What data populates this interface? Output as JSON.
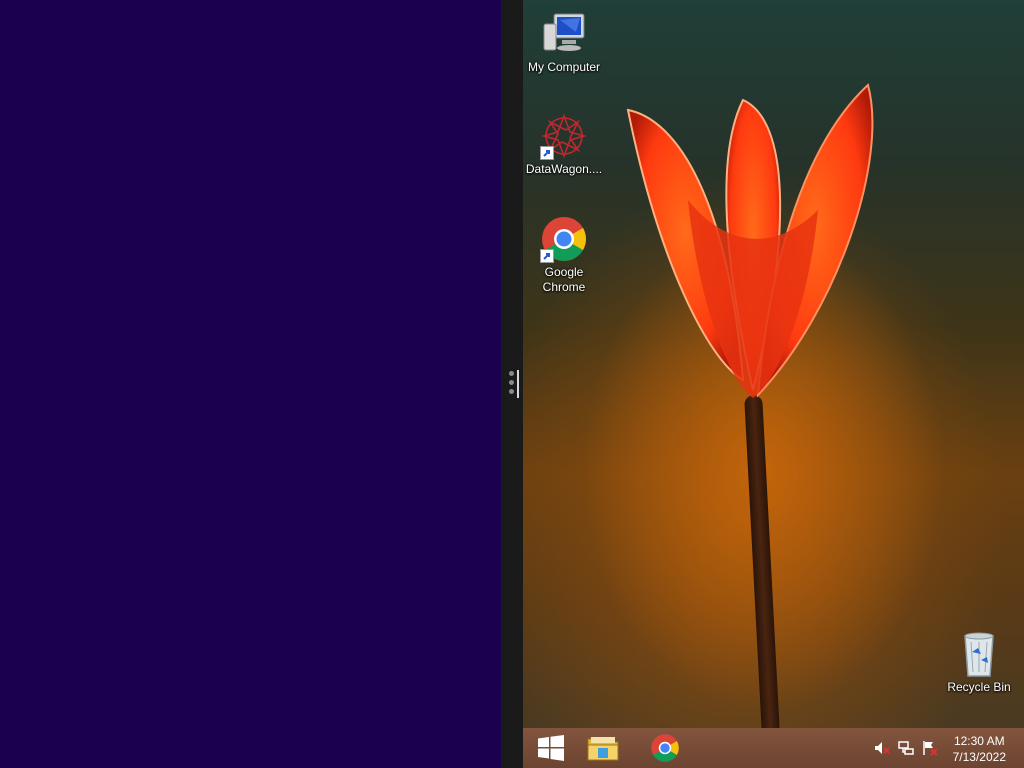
{
  "desktop": {
    "icons": [
      {
        "label": "My Computer",
        "icon": "computer-icon"
      },
      {
        "label": "DataWagon....",
        "icon": "datawagon-icon"
      },
      {
        "label": "Google Chrome",
        "icon": "chrome-icon"
      },
      {
        "label": "Recycle Bin",
        "icon": "recycle-bin-icon"
      }
    ]
  },
  "taskbar": {
    "buttons": [
      {
        "icon": "windows-start-icon"
      },
      {
        "icon": "file-explorer-icon"
      },
      {
        "icon": "chrome-icon"
      }
    ],
    "tray": [
      {
        "icon": "volume-muted-icon"
      },
      {
        "icon": "network-icon"
      },
      {
        "icon": "action-center-flag-icon"
      }
    ],
    "clock": {
      "time": "12:30 AM",
      "date": "7/13/2022"
    }
  },
  "colors": {
    "metro_panel": "#1b0050",
    "splitter": "#1a1a1a",
    "taskbar": "#74442d"
  }
}
